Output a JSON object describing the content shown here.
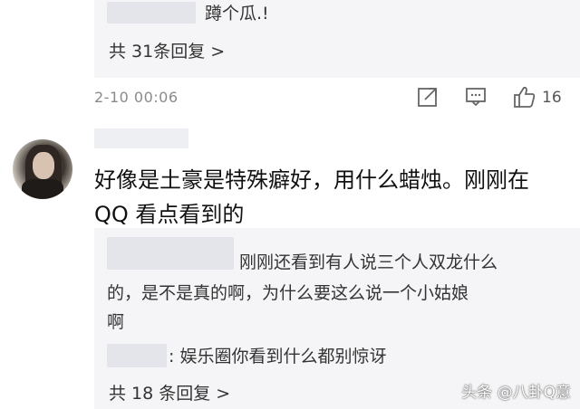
{
  "top_thread": {
    "reply_text": "蹲个瓜.!",
    "more_replies": "共 31条回复 >",
    "timestamp": "2-10 00:06",
    "like_count": "16"
  },
  "comment": {
    "line1": "好像是土豪是特殊癖好，用什么蜡烛。刚刚在",
    "line2": "QQ 看点看到的"
  },
  "replies": {
    "reply1_line1": "刚刚还看到有人说三个人双龙什么",
    "reply1_line2": "的，是不是真的啊，为什么要这么说一个小姑娘",
    "reply1_line3": "啊",
    "reply2": ": 娱乐圈你看到什么都别惊讶",
    "more_replies": "共 18 条回复 >"
  },
  "watermark": "头条 @八卦Q意",
  "icons": {
    "share": "share-icon",
    "comment": "comment-icon",
    "like": "thumbs-up-icon"
  }
}
